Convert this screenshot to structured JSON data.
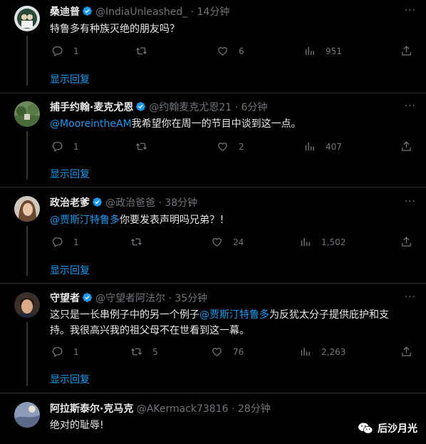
{
  "tweets": [
    {
      "name": "桑迪普",
      "handle": "@IndiaUnleashed_",
      "time": "· 14分钟",
      "text_plain": "特鲁多有种族灭绝的朋友吗？",
      "replies": "1",
      "retweets": "",
      "likes": "6",
      "views": "951",
      "show_replies": "显示回复",
      "more": "···"
    },
    {
      "name": "捕手约翰·麦克尤恩",
      "handle": "@约翰麦克尤恩21",
      "time": "· 6分钟",
      "mention": "@MooreintheAM",
      "text_rest": "我希望你在周一的节目中谈到这一点。",
      "replies": "1",
      "retweets": "",
      "likes": "2",
      "views": "407",
      "show_replies": "显示回复",
      "more": "···"
    },
    {
      "name": "政治老爹",
      "handle": "@政治爸爸",
      "time": "· 38分钟",
      "mention": "@贾斯汀特鲁多",
      "text_rest": "你要发表声明吗兄弟？！",
      "replies": "1",
      "retweets": "",
      "likes": "24",
      "views": "1,502",
      "show_replies": "显示回复",
      "more": "···"
    },
    {
      "name": "守望者",
      "handle": "@守望者阿法尔",
      "time": "· 35分钟",
      "text_before": "这只是一长串例子中的另一个例子",
      "mention": "@贾斯汀特鲁多",
      "text_line1_after": "为反犹太分子提供庇护和支",
      "text_line2": "持。我很高兴我的祖父母不在世看到这一幕。",
      "replies": "1",
      "retweets": "5",
      "likes": "76",
      "views": "2,263",
      "show_replies": "显示回复",
      "more": "···"
    },
    {
      "name": "阿拉斯泰尔·克马克",
      "handle": "@AKermack73816",
      "time": "· 28分钟",
      "text_plain": "绝对的耻辱!"
    }
  ],
  "watermark": "后沙月光",
  "colors": {
    "background": "#000000",
    "text": "#e7e9ea",
    "muted": "#71767b",
    "link": "#1d9bf0",
    "divider": "#2f3336"
  }
}
